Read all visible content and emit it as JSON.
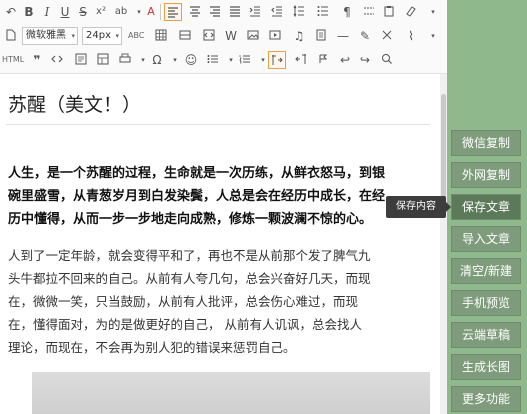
{
  "toolbar": {
    "font_family": "微软雅黑",
    "font_size": "24px",
    "html_label": "HTML",
    "abc_label": "ABC",
    "icons": [
      "undo-icon",
      "bold-icon",
      "italic-icon",
      "underline-icon",
      "strikethrough-icon",
      "superscript-icon",
      "forecolor-icon",
      "backcolor-icon",
      "align-left-icon",
      "align-center-icon",
      "align-right-icon",
      "align-justify-icon",
      "list-icon",
      "table-icon",
      "image-icon",
      "emotion-icon",
      "search-icon",
      "link-icon",
      "unlink-icon",
      "undo-icon",
      "redo-icon"
    ]
  },
  "editor": {
    "title": "苏醒（美文！）",
    "bold_lines": [
      "人生，是一个苏醒的过程，生命就是一次历练，从鲜衣怒马，到银",
      "碗里盛雪，从青葱岁月到白发染鬓，人总是会在经历中成长，在经",
      "历中懂得，从而一步一步地走向成熟，修炼一颗波澜不惊的心。"
    ],
    "normal_lines": [
      "人到了一定年龄，就会变得平和了，再也不是从前那个发了脾气九",
      "头牛都拉不回来的自己。从前有人夸几句，总会兴奋好几天，而现",
      "在，微微一笑，只当鼓励，从前有人批评，总会伤心难过，而现",
      "在，懂得面对，为的是做更好的自己，  从前有人讥讽，总会找人",
      "理论，而现在，不会再为别人犯的错误来惩罚自己。"
    ]
  },
  "sidebar": {
    "buttons": [
      "微信复制",
      "外网复制",
      "保存文章",
      "导入文章",
      "清空/新建",
      "手机预览",
      "云端草稿",
      "生成长图",
      "更多功能"
    ]
  },
  "tooltip": "保存内容",
  "colors": {
    "sidebar": "#8fb88d",
    "button": "#7e9c7b",
    "active_border": "#e6a04a"
  }
}
